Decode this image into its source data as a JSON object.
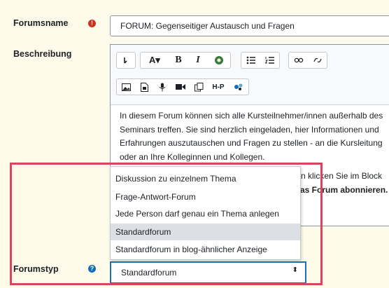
{
  "form": {
    "name_label": "Forumsname",
    "name_required_icon": "exclamation-circle-icon",
    "name_value": "FORUM: Gegenseitiger Austausch und Fragen",
    "desc_label": "Beschreibung",
    "type_label": "Forumstyp",
    "type_help_icon": "question-circle-icon"
  },
  "editor": {
    "toolbar_row1": [
      "¶-icon",
      "font-size-icon",
      "bold",
      "italic",
      "accessibility-icon",
      "unordered-list-icon",
      "ordered-list-icon",
      "link-icon",
      "unlink-icon"
    ],
    "toolbar_row2": [
      "image-icon",
      "media-icon",
      "record-audio-icon",
      "record-video-icon",
      "manage-files-icon",
      "h5p",
      "other-icon"
    ],
    "bold_label": "B",
    "italic_label": "I",
    "h5p_label": "H-P",
    "content_lines": [
      "In diesem Forum können sich alle Kursteilnehmer/innen außerhalb des",
      "Seminars treffen. Sie sind herzlich eingeladen, hier Informationen und",
      "Erfahrungen auszutauschen und Fragen zu stellen - an die Kursleitung",
      "oder an Ihre Kolleginnen und Kollegen."
    ],
    "partial_line1": "n klicken Sie im Block",
    "partial_line2_prefix": "as F",
    "partial_line2_bold": "orum abonnieren."
  },
  "dropdown": {
    "options": [
      "Diskussion zu einzelnem Thema",
      "Frage-Antwort-Forum",
      "Jede Person darf genau ein Thema anlegen",
      "Standardforum",
      "Standardforum in blog-ähnlicher Anzeige"
    ],
    "selected_index": 3,
    "selected_value": "Standardforum",
    "arrow": "⬍"
  },
  "colors": {
    "background": "#fffbea",
    "required": "#ca3120",
    "help": "#0f6cbf",
    "highlight": "#d9455f",
    "select_border": "#1f6fa8"
  }
}
